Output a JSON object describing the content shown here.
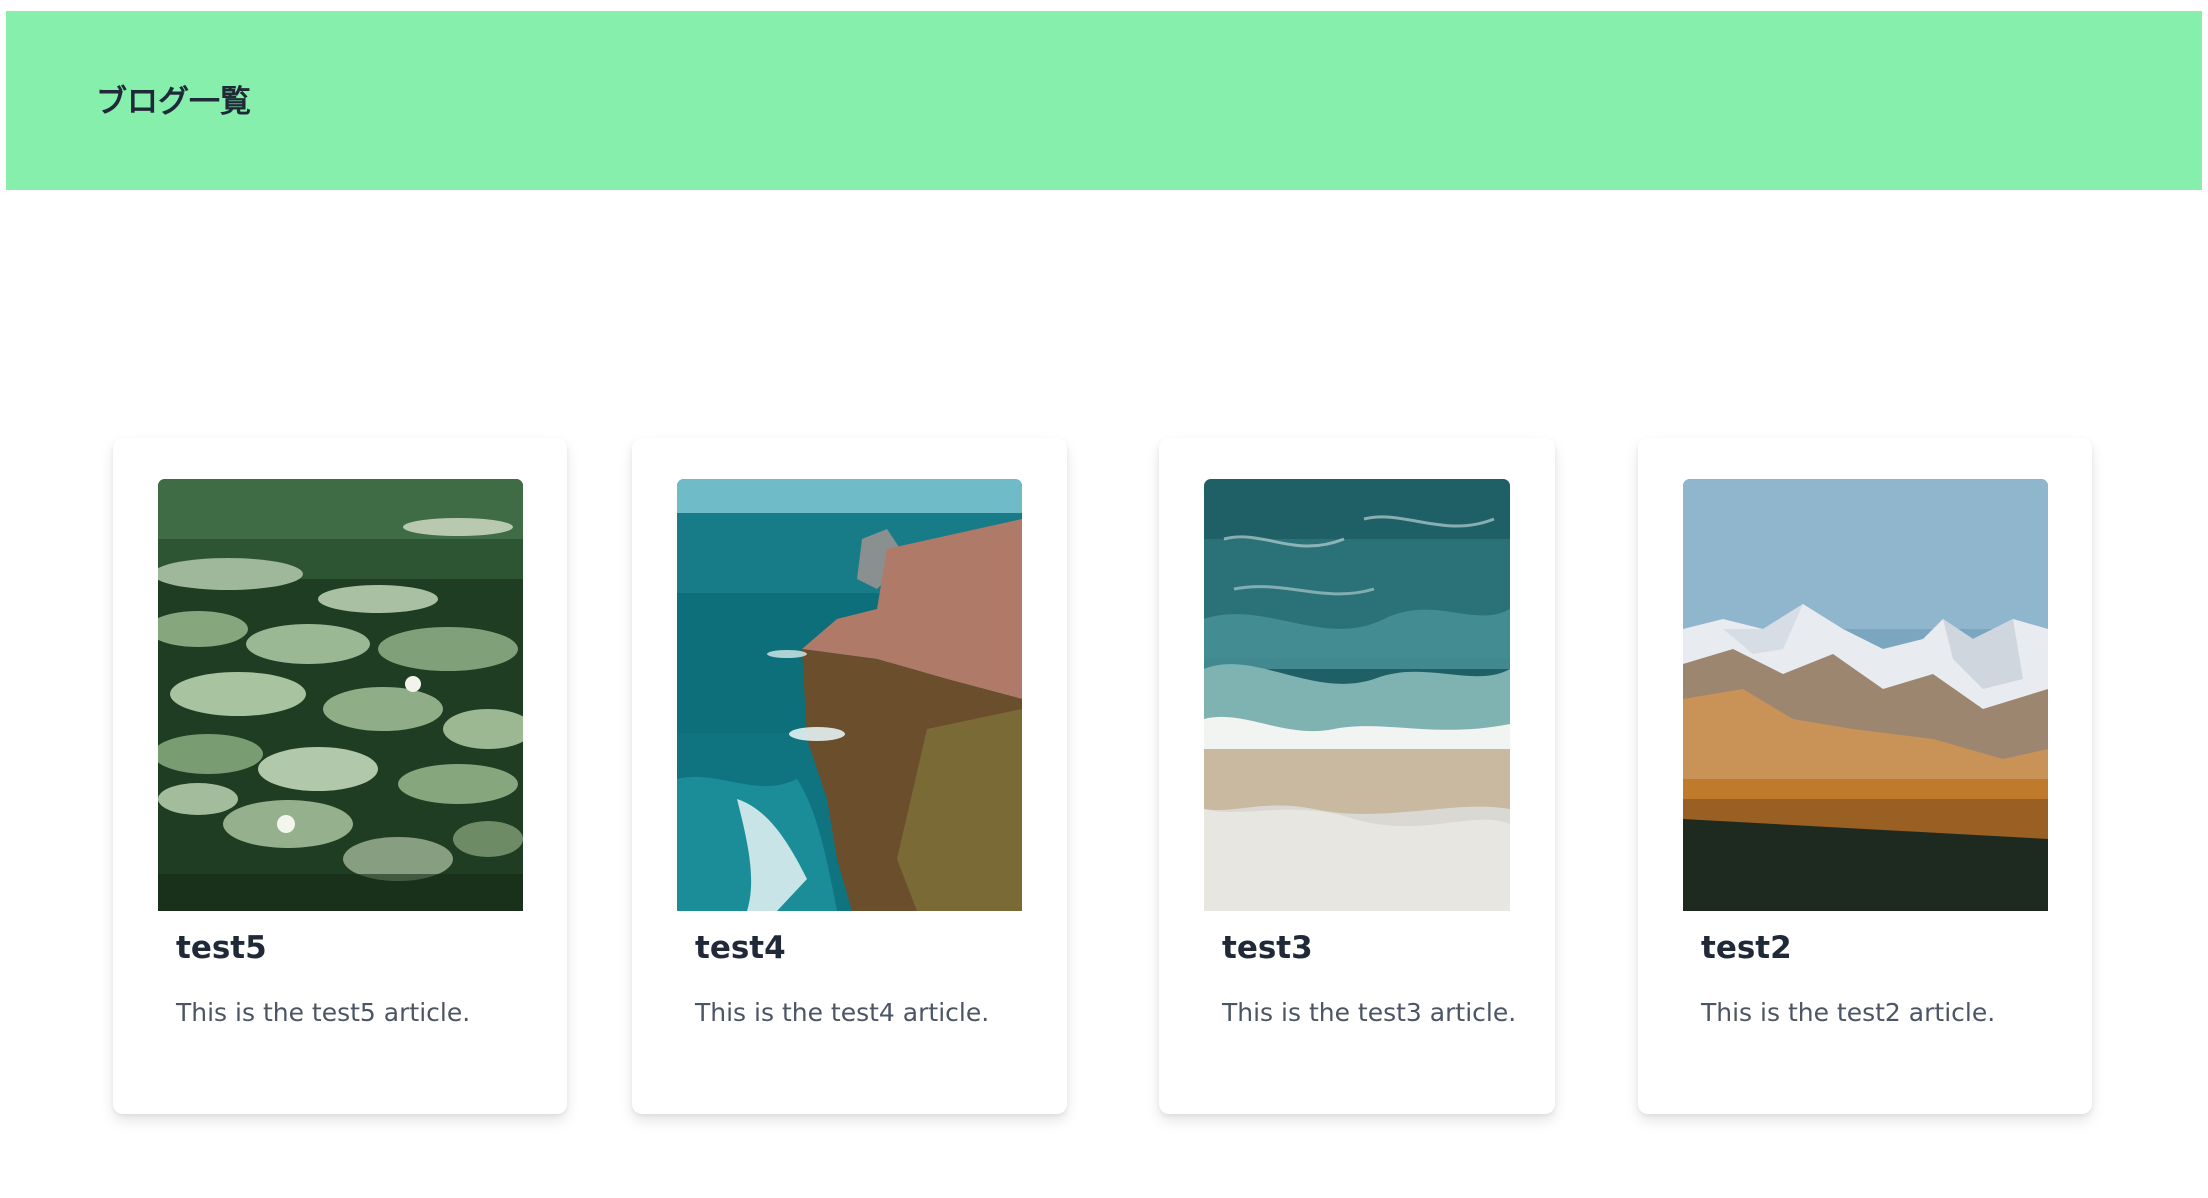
{
  "header": {
    "title": "ブログ一覧",
    "background": "#86efac"
  },
  "posts": [
    {
      "title": "test5",
      "description": "This is the test5 article.",
      "image_subject": "pond-with-water-lilies"
    },
    {
      "title": "test4",
      "description": "This is the test4 article.",
      "image_subject": "sea-cliffs-coastline"
    },
    {
      "title": "test3",
      "description": "This is the test3 article.",
      "image_subject": "aerial-ocean-waves"
    },
    {
      "title": "test2",
      "description": "This is the test2 article.",
      "image_subject": "snowy-mountains-forest"
    }
  ]
}
